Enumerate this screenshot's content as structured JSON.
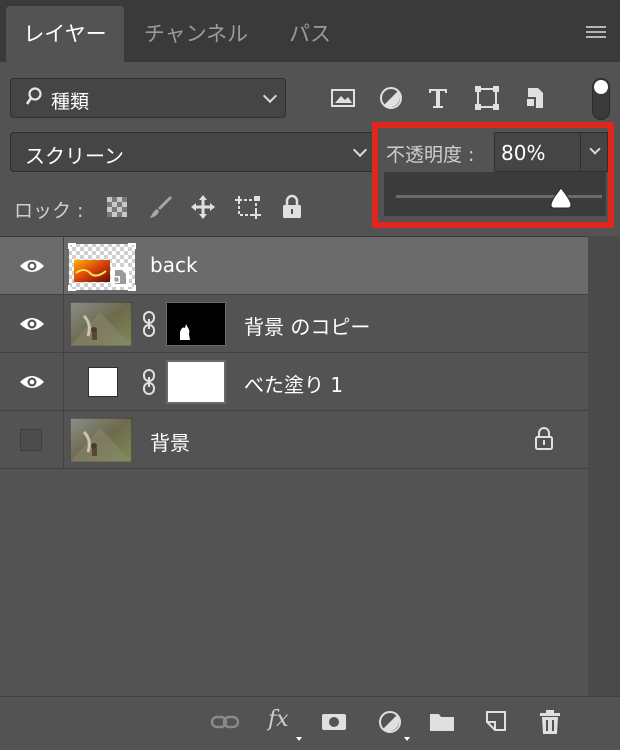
{
  "tabs": [
    {
      "label": "レイヤー",
      "active": true
    },
    {
      "label": "チャンネル",
      "active": false
    },
    {
      "label": "パス",
      "active": false
    }
  ],
  "filter": {
    "icon": "search-icon",
    "label": "種類"
  },
  "filter_icons": [
    "image-filter-icon",
    "adjustment-filter-icon",
    "type-filter-icon",
    "shape-filter-icon",
    "smart-object-filter-icon"
  ],
  "blend_mode": "スクリーン",
  "opacity": {
    "label": "不透明度 :",
    "value": "80%",
    "level": 0.8
  },
  "lock": {
    "label": "ロック :",
    "icons": [
      "lock-transparent-icon",
      "lock-image-icon",
      "lock-position-icon",
      "lock-artboard-icon",
      "lock-all-icon"
    ]
  },
  "layers": [
    {
      "name": "back",
      "visible": true,
      "selected": true,
      "type": "smart-object"
    },
    {
      "name": "背景 のコピー",
      "visible": true,
      "selected": false,
      "type": "masked"
    },
    {
      "name": "べた塗り 1",
      "visible": true,
      "selected": false,
      "type": "fill"
    },
    {
      "name": "背景",
      "visible": false,
      "selected": false,
      "type": "background",
      "locked": true
    }
  ],
  "bottom_icons": [
    "link-layers-icon",
    "fx-icon",
    "add-mask-icon",
    "new-adjustment-icon",
    "new-group-icon",
    "new-layer-icon",
    "delete-icon"
  ],
  "fx_label": "fx",
  "colors": {
    "panel": "#535353",
    "tabbar": "#3a3a3a",
    "selected_row": "#6b6b6b",
    "highlight": "#e0271f"
  }
}
